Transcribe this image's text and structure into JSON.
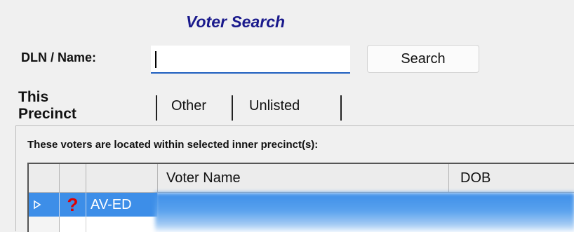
{
  "header": {
    "title": "Voter Search"
  },
  "search": {
    "label": "DLN / Name:",
    "value": "",
    "button_label": "Search"
  },
  "tabs": [
    {
      "label": "This Precinct",
      "active": true
    },
    {
      "label": "Other",
      "active": false
    },
    {
      "label": "Unlisted",
      "active": false
    }
  ],
  "panel": {
    "note": "These voters are located within selected inner precinct(s):"
  },
  "grid": {
    "columns": [
      "",
      "",
      "",
      "Voter Name",
      "DOB"
    ],
    "rows": [
      {
        "status_icon": "question-icon",
        "code": "AV-ED",
        "name": "",
        "dob": ""
      }
    ]
  },
  "colors": {
    "title": "#1a1a8c",
    "selection": "#3d8ee8",
    "input_underline": "#1f5fbf"
  }
}
